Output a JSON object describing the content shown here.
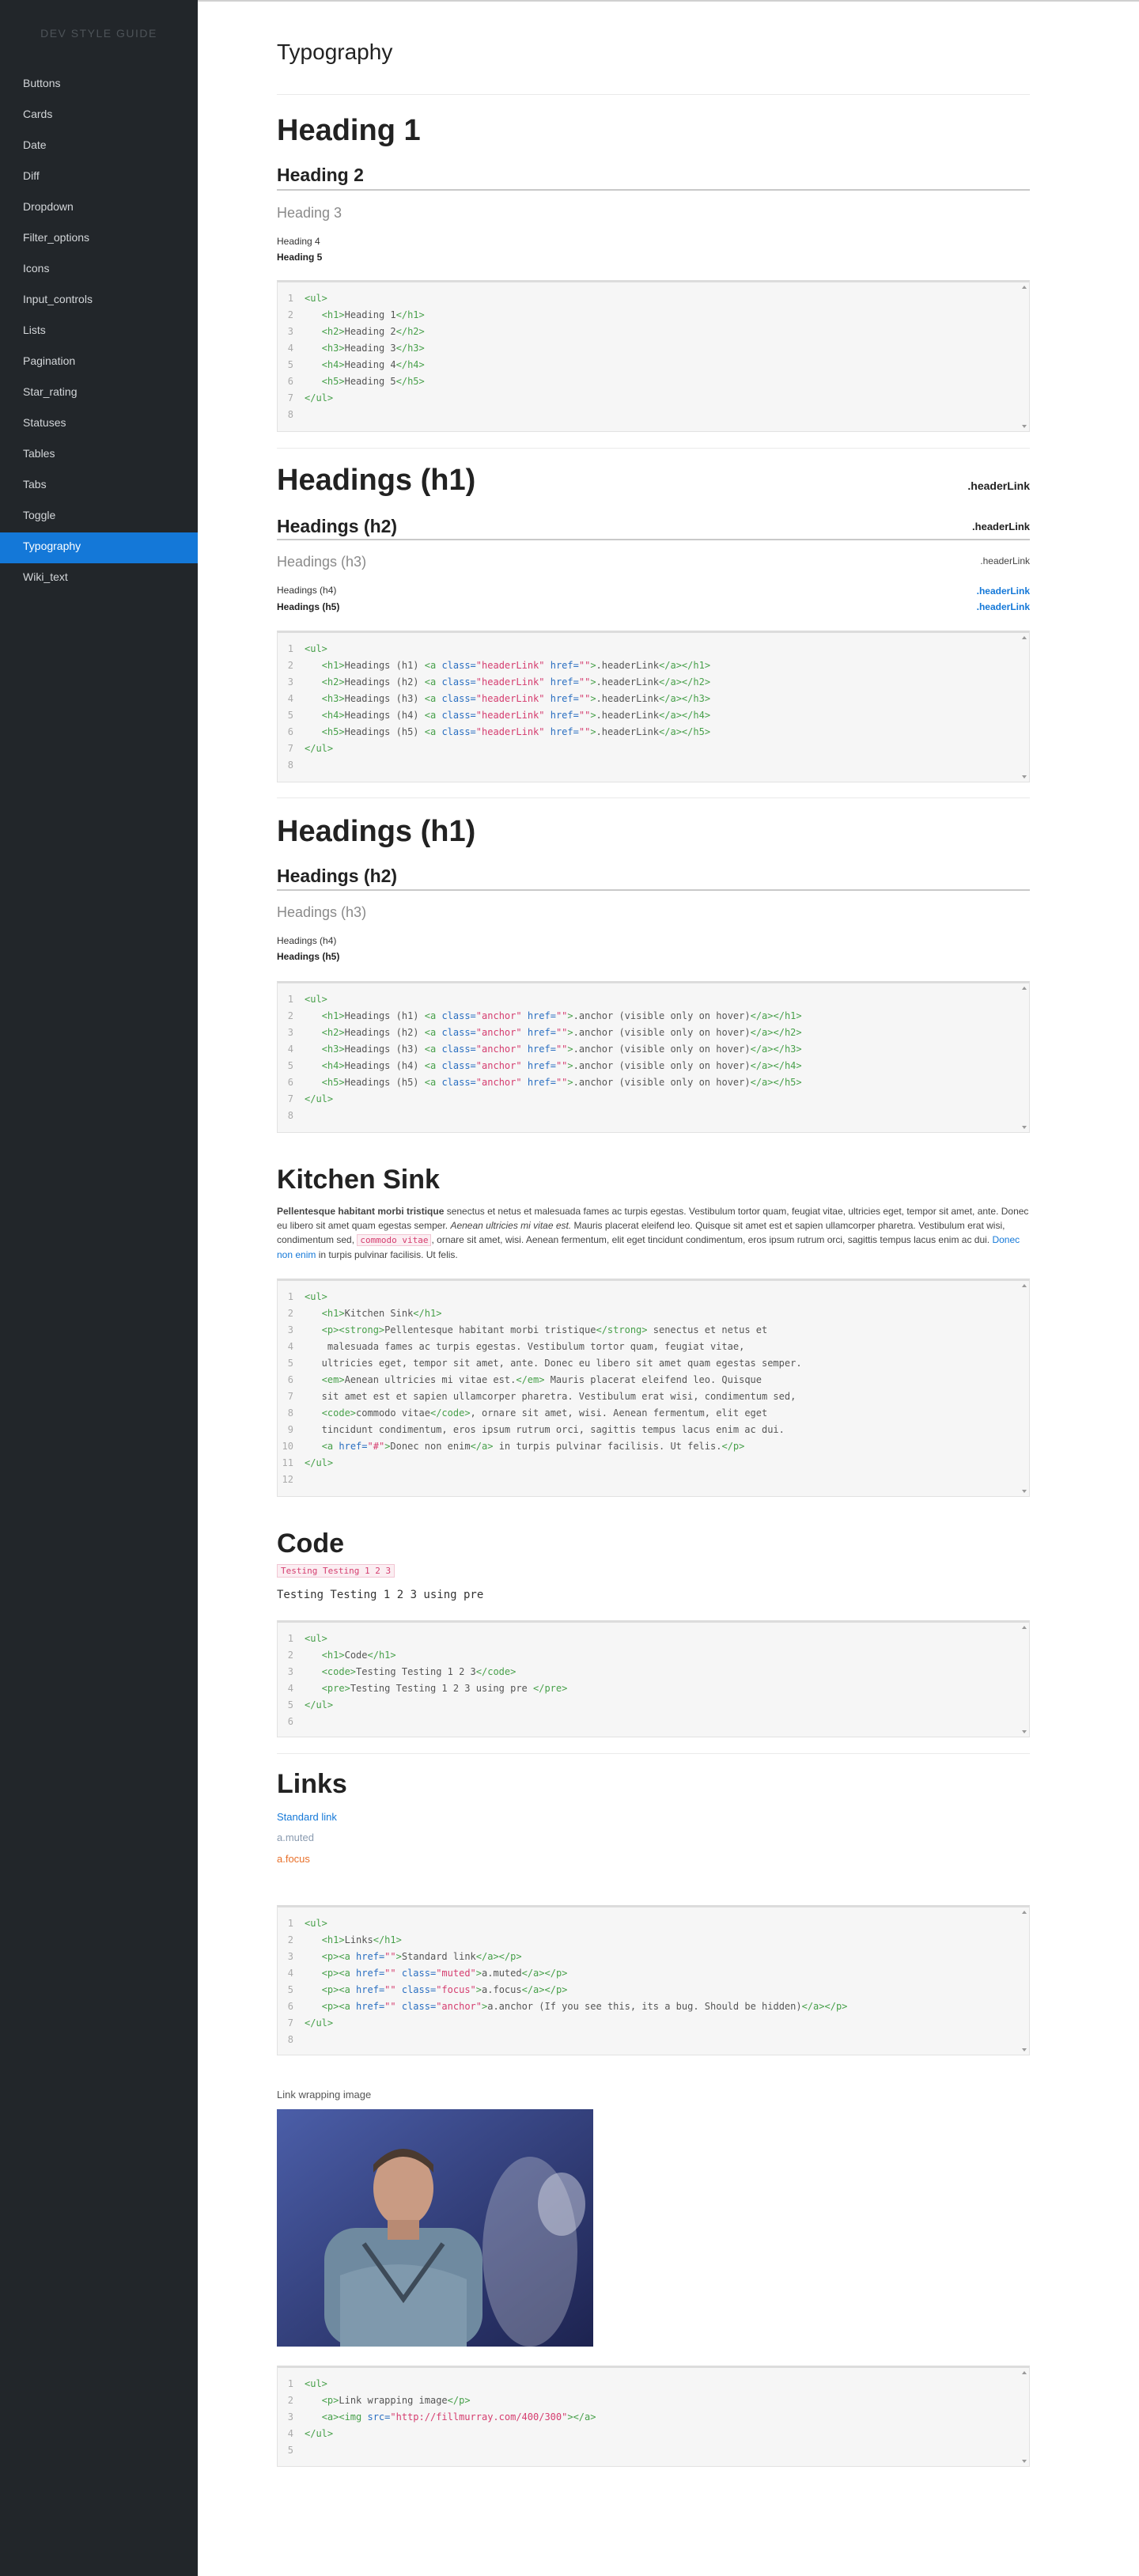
{
  "brand": "DEV STYLE GUIDE",
  "nav": [
    "Buttons",
    "Cards",
    "Date",
    "Diff",
    "Dropdown",
    "Filter_options",
    "Icons",
    "Input_controls",
    "Lists",
    "Pagination",
    "Star_rating",
    "Statuses",
    "Tables",
    "Tabs",
    "Toggle",
    "Typography",
    "Wiki_text"
  ],
  "active_nav": "Typography",
  "page_title": "Typography",
  "s1": {
    "h1": "Heading 1",
    "h2": "Heading 2",
    "h3": "Heading 3",
    "h4": "Heading 4",
    "h5": "Heading 5"
  },
  "s2": {
    "h1": "Headings (h1)",
    "h2": "Headings (h2)",
    "h3": "Headings (h3)",
    "h4": "Headings (h4)",
    "h5": "Headings (h5)",
    "link": ".headerLink"
  },
  "s3": {
    "h1": "Headings (h1)",
    "h2": "Headings (h2)",
    "h3": "Headings (h3)",
    "h4": "Headings (h4)",
    "h5": "Headings (h5)"
  },
  "sink": {
    "title": "Kitchen Sink",
    "strong": "Pellentesque habitant morbi tristique",
    "p1": " senectus et netus et malesuada fames ac turpis egestas. Vestibulum tortor quam, feugiat vitae, ultricies eget, tempor sit amet, ante. Donec eu libero sit amet quam egestas semper. ",
    "em": "Aenean ultricies mi vitae est.",
    "p2": " Mauris placerat eleifend leo. Quisque sit amet est et sapien ullamcorper pharetra. Vestibulum erat wisi, condimentum sed, ",
    "code": "commodo vitae",
    "p3": ", ornare sit amet, wisi. Aenean fermentum, elit eget tincidunt condimentum, eros ipsum rutrum orci, sagittis tempus lacus enim ac dui. ",
    "link": "Donec non enim",
    "p4": " in turpis pulvinar facilisis. Ut felis."
  },
  "code_section": {
    "title": "Code",
    "inline": "Testing Testing 1 2 3",
    "pre": "Testing Testing 1 2 3 using pre"
  },
  "links": {
    "title": "Links",
    "standard": "Standard link",
    "muted": "a.muted",
    "focus": "a.focus"
  },
  "image_caption": "Link wrapping image",
  "colors": {
    "sidebar": "#22262a",
    "accent": "#1478d8",
    "tag": "#47a04a",
    "attr": "#2a6fc1",
    "string": "#d53d6f",
    "focus": "#e8702a",
    "muted": "#8a9bb0"
  },
  "code_blocks": [
    {
      "id": "cb1",
      "lines": [
        [
          [
            "t",
            "<ul>"
          ]
        ],
        [
          [
            "x",
            "   "
          ],
          [
            "t",
            "<h1>"
          ],
          [
            "x",
            "Heading 1"
          ],
          [
            "t",
            "</h1>"
          ]
        ],
        [
          [
            "x",
            "   "
          ],
          [
            "t",
            "<h2>"
          ],
          [
            "x",
            "Heading 2"
          ],
          [
            "t",
            "</h2>"
          ]
        ],
        [
          [
            "x",
            "   "
          ],
          [
            "t",
            "<h3>"
          ],
          [
            "x",
            "Heading 3"
          ],
          [
            "t",
            "</h3>"
          ]
        ],
        [
          [
            "x",
            "   "
          ],
          [
            "t",
            "<h4>"
          ],
          [
            "x",
            "Heading 4"
          ],
          [
            "t",
            "</h4>"
          ]
        ],
        [
          [
            "x",
            "   "
          ],
          [
            "t",
            "<h5>"
          ],
          [
            "x",
            "Heading 5"
          ],
          [
            "t",
            "</h5>"
          ]
        ],
        [
          [
            "t",
            "</ul>"
          ]
        ],
        []
      ]
    },
    {
      "id": "cb2",
      "lines": [
        [
          [
            "t",
            "<ul>"
          ]
        ],
        [
          [
            "x",
            "   "
          ],
          [
            "t",
            "<h1>"
          ],
          [
            "x",
            "Headings (h1) "
          ],
          [
            "t",
            "<a "
          ],
          [
            "a",
            "class="
          ],
          [
            "s",
            "\"headerLink\""
          ],
          [
            "a",
            " href="
          ],
          [
            "s",
            "\"\""
          ],
          [
            "t",
            ">"
          ],
          [
            "x",
            ".headerLink"
          ],
          [
            "t",
            "</a></h1>"
          ]
        ],
        [
          [
            "x",
            "   "
          ],
          [
            "t",
            "<h2>"
          ],
          [
            "x",
            "Headings (h2) "
          ],
          [
            "t",
            "<a "
          ],
          [
            "a",
            "class="
          ],
          [
            "s",
            "\"headerLink\""
          ],
          [
            "a",
            " href="
          ],
          [
            "s",
            "\"\""
          ],
          [
            "t",
            ">"
          ],
          [
            "x",
            ".headerLink"
          ],
          [
            "t",
            "</a></h2>"
          ]
        ],
        [
          [
            "x",
            "   "
          ],
          [
            "t",
            "<h3>"
          ],
          [
            "x",
            "Headings (h3) "
          ],
          [
            "t",
            "<a "
          ],
          [
            "a",
            "class="
          ],
          [
            "s",
            "\"headerLink\""
          ],
          [
            "a",
            " href="
          ],
          [
            "s",
            "\"\""
          ],
          [
            "t",
            ">"
          ],
          [
            "x",
            ".headerLink"
          ],
          [
            "t",
            "</a></h3>"
          ]
        ],
        [
          [
            "x",
            "   "
          ],
          [
            "t",
            "<h4>"
          ],
          [
            "x",
            "Headings (h4) "
          ],
          [
            "t",
            "<a "
          ],
          [
            "a",
            "class="
          ],
          [
            "s",
            "\"headerLink\""
          ],
          [
            "a",
            " href="
          ],
          [
            "s",
            "\"\""
          ],
          [
            "t",
            ">"
          ],
          [
            "x",
            ".headerLink"
          ],
          [
            "t",
            "</a></h4>"
          ]
        ],
        [
          [
            "x",
            "   "
          ],
          [
            "t",
            "<h5>"
          ],
          [
            "x",
            "Headings (h5) "
          ],
          [
            "t",
            "<a "
          ],
          [
            "a",
            "class="
          ],
          [
            "s",
            "\"headerLink\""
          ],
          [
            "a",
            " href="
          ],
          [
            "s",
            "\"\""
          ],
          [
            "t",
            ">"
          ],
          [
            "x",
            ".headerLink"
          ],
          [
            "t",
            "</a></h5>"
          ]
        ],
        [
          [
            "t",
            "</ul>"
          ]
        ],
        []
      ]
    },
    {
      "id": "cb3",
      "lines": [
        [
          [
            "t",
            "<ul>"
          ]
        ],
        [
          [
            "x",
            "   "
          ],
          [
            "t",
            "<h1>"
          ],
          [
            "x",
            "Headings (h1) "
          ],
          [
            "t",
            "<a "
          ],
          [
            "a",
            "class="
          ],
          [
            "s",
            "\"anchor\""
          ],
          [
            "a",
            " href="
          ],
          [
            "s",
            "\"\""
          ],
          [
            "t",
            ">"
          ],
          [
            "x",
            ".anchor (visible only on hover)"
          ],
          [
            "t",
            "</a></h1>"
          ]
        ],
        [
          [
            "x",
            "   "
          ],
          [
            "t",
            "<h2>"
          ],
          [
            "x",
            "Headings (h2) "
          ],
          [
            "t",
            "<a "
          ],
          [
            "a",
            "class="
          ],
          [
            "s",
            "\"anchor\""
          ],
          [
            "a",
            " href="
          ],
          [
            "s",
            "\"\""
          ],
          [
            "t",
            ">"
          ],
          [
            "x",
            ".anchor (visible only on hover)"
          ],
          [
            "t",
            "</a></h2>"
          ]
        ],
        [
          [
            "x",
            "   "
          ],
          [
            "t",
            "<h3>"
          ],
          [
            "x",
            "Headings (h3) "
          ],
          [
            "t",
            "<a "
          ],
          [
            "a",
            "class="
          ],
          [
            "s",
            "\"anchor\""
          ],
          [
            "a",
            " href="
          ],
          [
            "s",
            "\"\""
          ],
          [
            "t",
            ">"
          ],
          [
            "x",
            ".anchor (visible only on hover)"
          ],
          [
            "t",
            "</a></h3>"
          ]
        ],
        [
          [
            "x",
            "   "
          ],
          [
            "t",
            "<h4>"
          ],
          [
            "x",
            "Headings (h4) "
          ],
          [
            "t",
            "<a "
          ],
          [
            "a",
            "class="
          ],
          [
            "s",
            "\"anchor\""
          ],
          [
            "a",
            " href="
          ],
          [
            "s",
            "\"\""
          ],
          [
            "t",
            ">"
          ],
          [
            "x",
            ".anchor (visible only on hover)"
          ],
          [
            "t",
            "</a></h4>"
          ]
        ],
        [
          [
            "x",
            "   "
          ],
          [
            "t",
            "<h5>"
          ],
          [
            "x",
            "Headings (h5) "
          ],
          [
            "t",
            "<a "
          ],
          [
            "a",
            "class="
          ],
          [
            "s",
            "\"anchor\""
          ],
          [
            "a",
            " href="
          ],
          [
            "s",
            "\"\""
          ],
          [
            "t",
            ">"
          ],
          [
            "x",
            ".anchor (visible only on hover)"
          ],
          [
            "t",
            "</a></h5>"
          ]
        ],
        [
          [
            "t",
            "</ul>"
          ]
        ],
        []
      ]
    },
    {
      "id": "cb4",
      "lines": [
        [
          [
            "t",
            "<ul>"
          ]
        ],
        [
          [
            "x",
            "   "
          ],
          [
            "t",
            "<h1>"
          ],
          [
            "x",
            "Kitchen Sink"
          ],
          [
            "t",
            "</h1>"
          ]
        ],
        [
          [
            "x",
            "   "
          ],
          [
            "t",
            "<p><strong>"
          ],
          [
            "x",
            "Pellentesque habitant morbi tristique"
          ],
          [
            "t",
            "</strong>"
          ],
          [
            "x",
            " senectus et netus et"
          ]
        ],
        [
          [
            "x",
            "    malesuada fames ac turpis egestas. Vestibulum tortor quam, feugiat vitae,"
          ]
        ],
        [
          [
            "x",
            "   ultricies eget, tempor sit amet, ante. Donec eu libero sit amet quam egestas semper."
          ]
        ],
        [
          [
            "x",
            "   "
          ],
          [
            "t",
            "<em>"
          ],
          [
            "x",
            "Aenean ultricies mi vitae est."
          ],
          [
            "t",
            "</em>"
          ],
          [
            "x",
            " Mauris placerat eleifend leo. Quisque"
          ]
        ],
        [
          [
            "x",
            "   sit amet est et sapien ullamcorper pharetra. Vestibulum erat wisi, condimentum sed,"
          ]
        ],
        [
          [
            "x",
            "   "
          ],
          [
            "t",
            "<code>"
          ],
          [
            "x",
            "commodo vitae"
          ],
          [
            "t",
            "</code>"
          ],
          [
            "x",
            ", ornare sit amet, wisi. Aenean fermentum, elit eget"
          ]
        ],
        [
          [
            "x",
            "   tincidunt condimentum, eros ipsum rutrum orci, sagittis tempus lacus enim ac dui."
          ]
        ],
        [
          [
            "x",
            "   "
          ],
          [
            "t",
            "<a "
          ],
          [
            "a",
            "href="
          ],
          [
            "s",
            "\"#\""
          ],
          [
            "t",
            ">"
          ],
          [
            "x",
            "Donec non enim"
          ],
          [
            "t",
            "</a>"
          ],
          [
            "x",
            " in turpis pulvinar facilisis. Ut felis."
          ],
          [
            "t",
            "</p>"
          ]
        ],
        [
          [
            "t",
            "</ul>"
          ]
        ],
        []
      ]
    },
    {
      "id": "cb5",
      "lines": [
        [
          [
            "t",
            "<ul>"
          ]
        ],
        [
          [
            "x",
            "   "
          ],
          [
            "t",
            "<h1>"
          ],
          [
            "x",
            "Code"
          ],
          [
            "t",
            "</h1>"
          ]
        ],
        [
          [
            "x",
            "   "
          ],
          [
            "t",
            "<code>"
          ],
          [
            "x",
            "Testing Testing 1 2 3"
          ],
          [
            "t",
            "</code>"
          ]
        ],
        [
          [
            "x",
            "   "
          ],
          [
            "t",
            "<pre>"
          ],
          [
            "x",
            "Testing Testing 1 2 3 using pre "
          ],
          [
            "t",
            "</pre>"
          ]
        ],
        [
          [
            "t",
            "</ul>"
          ]
        ],
        []
      ]
    },
    {
      "id": "cb6",
      "lines": [
        [
          [
            "t",
            "<ul>"
          ]
        ],
        [
          [
            "x",
            "   "
          ],
          [
            "t",
            "<h1>"
          ],
          [
            "x",
            "Links"
          ],
          [
            "t",
            "</h1>"
          ]
        ],
        [
          [
            "x",
            "   "
          ],
          [
            "t",
            "<p><a "
          ],
          [
            "a",
            "href="
          ],
          [
            "s",
            "\"\""
          ],
          [
            "t",
            ">"
          ],
          [
            "x",
            "Standard link"
          ],
          [
            "t",
            "</a></p>"
          ]
        ],
        [
          [
            "x",
            "   "
          ],
          [
            "t",
            "<p><a "
          ],
          [
            "a",
            "href="
          ],
          [
            "s",
            "\"\""
          ],
          [
            "a",
            " class="
          ],
          [
            "s",
            "\"muted\""
          ],
          [
            "t",
            ">"
          ],
          [
            "x",
            "a.muted"
          ],
          [
            "t",
            "</a></p>"
          ]
        ],
        [
          [
            "x",
            "   "
          ],
          [
            "t",
            "<p><a "
          ],
          [
            "a",
            "href="
          ],
          [
            "s",
            "\"\""
          ],
          [
            "a",
            " class="
          ],
          [
            "s",
            "\"focus\""
          ],
          [
            "t",
            ">"
          ],
          [
            "x",
            "a.focus"
          ],
          [
            "t",
            "</a></p>"
          ]
        ],
        [
          [
            "x",
            "   "
          ],
          [
            "t",
            "<p><a "
          ],
          [
            "a",
            "href="
          ],
          [
            "s",
            "\"\""
          ],
          [
            "a",
            " class="
          ],
          [
            "s",
            "\"anchor\""
          ],
          [
            "t",
            ">"
          ],
          [
            "x",
            "a.anchor (If you see this, its a bug. Should be hidden)"
          ],
          [
            "t",
            "</a></p>"
          ]
        ],
        [
          [
            "t",
            "</ul>"
          ]
        ],
        []
      ]
    },
    {
      "id": "cb7",
      "lines": [
        [
          [
            "t",
            "<ul>"
          ]
        ],
        [
          [
            "x",
            "   "
          ],
          [
            "t",
            "<p>"
          ],
          [
            "x",
            "Link wrapping image"
          ],
          [
            "t",
            "</p>"
          ]
        ],
        [
          [
            "x",
            "   "
          ],
          [
            "t",
            "<a><img "
          ],
          [
            "a",
            "src="
          ],
          [
            "s",
            "\"http://fillmurray.com/400/300\""
          ],
          [
            "t",
            "></a>"
          ]
        ],
        [
          [
            "t",
            "</ul>"
          ]
        ],
        []
      ]
    }
  ]
}
